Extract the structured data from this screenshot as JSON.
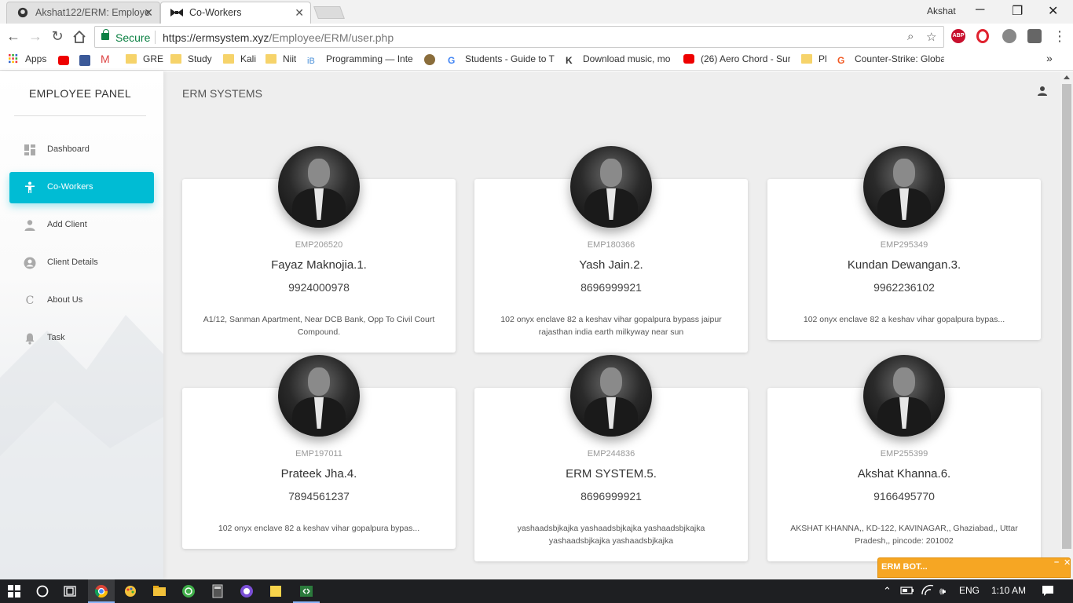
{
  "browser": {
    "tabs": [
      {
        "title": "Akshat122/ERM: Employe"
      },
      {
        "title": "Co-Workers"
      }
    ],
    "profile_name": "Akshat",
    "secure_label": "Secure",
    "url_host": "https://ermsystem.xyz",
    "url_path": "/Employee/ERM/user.php",
    "bookmarks": [
      "Apps",
      "GRE",
      "Study",
      "Kali",
      "Niit",
      "Programming — Inte",
      "Students - Guide to T",
      "Download music, mo",
      "(26) Aero Chord - Sur",
      "Pl",
      "Counter-Strike: Globa"
    ]
  },
  "sidebar": {
    "brand": "EMPLOYEE PANEL",
    "items": [
      {
        "label": "Dashboard",
        "icon": "dashboard-icon",
        "active": false
      },
      {
        "label": "Co-Workers",
        "icon": "person-icon",
        "active": true
      },
      {
        "label": "Add Client",
        "icon": "add-person-icon",
        "active": false
      },
      {
        "label": "Client Details",
        "icon": "account-circle-icon",
        "active": false
      },
      {
        "label": "About Us",
        "icon": "c-letter-icon",
        "active": false
      },
      {
        "label": "Task",
        "icon": "bell-icon",
        "active": false
      }
    ]
  },
  "header": {
    "title": "ERM SYSTEMS"
  },
  "employees": [
    {
      "id": "EMP206520",
      "name": "Fayaz Maknojia.1.",
      "phone": "9924000978",
      "address": "A1/12, Sanman Apartment, Near DCB Bank, Opp To Civil Court Compound."
    },
    {
      "id": "EMP180366",
      "name": "Yash Jain.2.",
      "phone": "8696999921",
      "address": "102 onyx enclave 82 a keshav vihar gopalpura bypass jaipur rajasthan india earth milkyway near sun"
    },
    {
      "id": "EMP295349",
      "name": "Kundan Dewangan.3.",
      "phone": "9962236102",
      "address": "102 onyx enclave 82 a keshav vihar gopalpura bypas..."
    },
    {
      "id": "EMP197011",
      "name": "Prateek Jha.4.",
      "phone": "7894561237",
      "address": "102 onyx enclave 82 a keshav vihar gopalpura bypas..."
    },
    {
      "id": "EMP244836",
      "name": "ERM SYSTEM.5.",
      "phone": "8696999921",
      "address": "yashaadsbjkajka yashaadsbjkajka yashaadsbjkajka yashaadsbjkajka yashaadsbjkajka"
    },
    {
      "id": "EMP255399",
      "name": "Akshat Khanna.6.",
      "phone": "9166495770",
      "address": "AKSHAT KHANNA,, KD-122, KAVINAGAR,, Ghaziabad,, Uttar Pradesh,, pincode: 201002"
    }
  ],
  "chat_widget": {
    "title": "ERM BOT..."
  },
  "taskbar": {
    "language": "ENG",
    "time": "1:10 AM"
  },
  "colors": {
    "accent": "#00bcd4",
    "secure_green": "#0b8043",
    "bot_orange": "#f6a623",
    "page_bg": "#eeeeee"
  }
}
